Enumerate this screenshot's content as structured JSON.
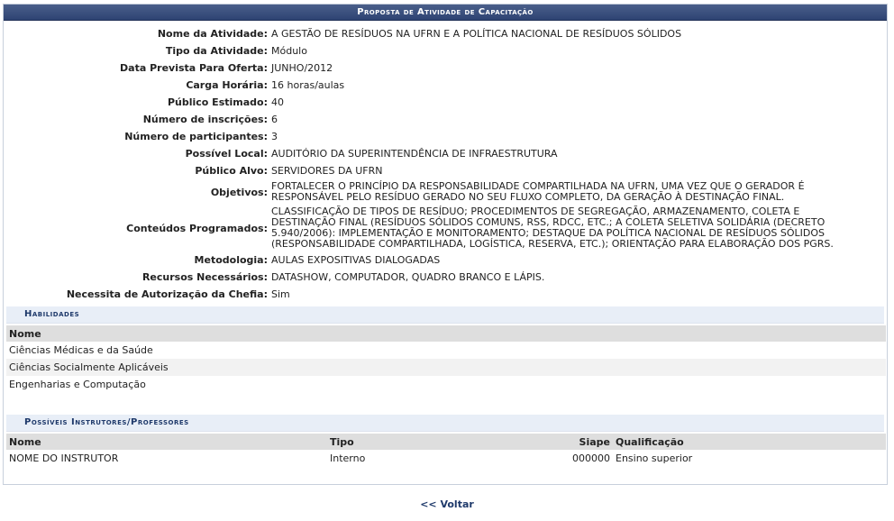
{
  "panel": {
    "title": "Proposta de Atividade de Capacitação"
  },
  "fields": [
    {
      "label": "Nome da Atividade:",
      "value": "A GESTÃO DE RESÍDUOS NA UFRN E A POLÍTICA NACIONAL DE RESÍDUOS SÓLIDOS"
    },
    {
      "label": "Tipo da Atividade:",
      "value": "Módulo"
    },
    {
      "label": "Data Prevista Para Oferta:",
      "value": "JUNHO/2012"
    },
    {
      "label": "Carga Horária:",
      "value": "16 horas/aulas"
    },
    {
      "label": "Público Estimado:",
      "value": "40"
    },
    {
      "label": "Número de inscrições:",
      "value": "6"
    },
    {
      "label": "Número de participantes:",
      "value": "3"
    },
    {
      "label": "Possível Local:",
      "value": "AUDITÓRIO DA SUPERINTENDÊNCIA DE INFRAESTRUTURA"
    },
    {
      "label": "Público Alvo:",
      "value": "SERVIDORES DA UFRN"
    },
    {
      "label": "Objetivos:",
      "value": "FORTALECER O PRINCÍPIO DA RESPONSABILIDADE COMPARTILHADA NA UFRN, UMA VEZ QUE O GERADOR É\nRESPONSÁVEL PELO RESÍDUO GERADO NO SEU FLUXO COMPLETO, DA GERAÇÃO À DESTINAÇÃO FINAL."
    },
    {
      "label": "Conteúdos Programados:",
      "value": "CLASSIFICAÇÃO DE TIPOS DE RESÍDUO; PROCEDIMENTOS DE SEGREGAÇÃO, ARMAZENAMENTO, COLETA E\nDESTINAÇÃO FINAL (RESÍDUOS SÓLIDOS COMUNS, RSS, RDCC, ETC.; A COLETA SELETIVA SOLIDÁRIA (DECRETO\n5.940/2006): IMPLEMENTAÇÃO E MONITORAMENTO; DESTAQUE DA POLÍTICA NACIONAL DE RESÍDUOS SÓLIDOS\n(RESPONSABILIDADE COMPARTILHADA, LOGÍSTICA, RESERVA, ETC.); ORIENTAÇÃO PARA ELABORAÇÃO DOS PGRS."
    },
    {
      "label": "Metodologia:",
      "value": "AULAS EXPOSITIVAS DIALOGADAS"
    },
    {
      "label": "Recursos Necessários:",
      "value": "DATASHOW, COMPUTADOR, QUADRO BRANCO E LÁPIS."
    },
    {
      "label": "Necessita de Autorização da Chefia:",
      "value": "Sim"
    }
  ],
  "habilidades": {
    "title": "Habilidades",
    "header": "Nome",
    "rows": [
      "Ciências Médicas e da Saúde",
      "Ciências Socialmente Aplicáveis",
      "Engenharias e Computação"
    ]
  },
  "instrutores": {
    "title": "Possíveis Instrutores/Professores",
    "headers": {
      "nome": "Nome",
      "tipo": "Tipo",
      "siape": "Siape",
      "qualificacao": "Qualificação"
    },
    "rows": [
      {
        "nome": "NOME DO INSTRUTOR",
        "tipo": "Interno",
        "siape": "000000",
        "qualificacao": "Ensino superior"
      }
    ]
  },
  "nav": {
    "back_label": "<< Voltar"
  }
}
